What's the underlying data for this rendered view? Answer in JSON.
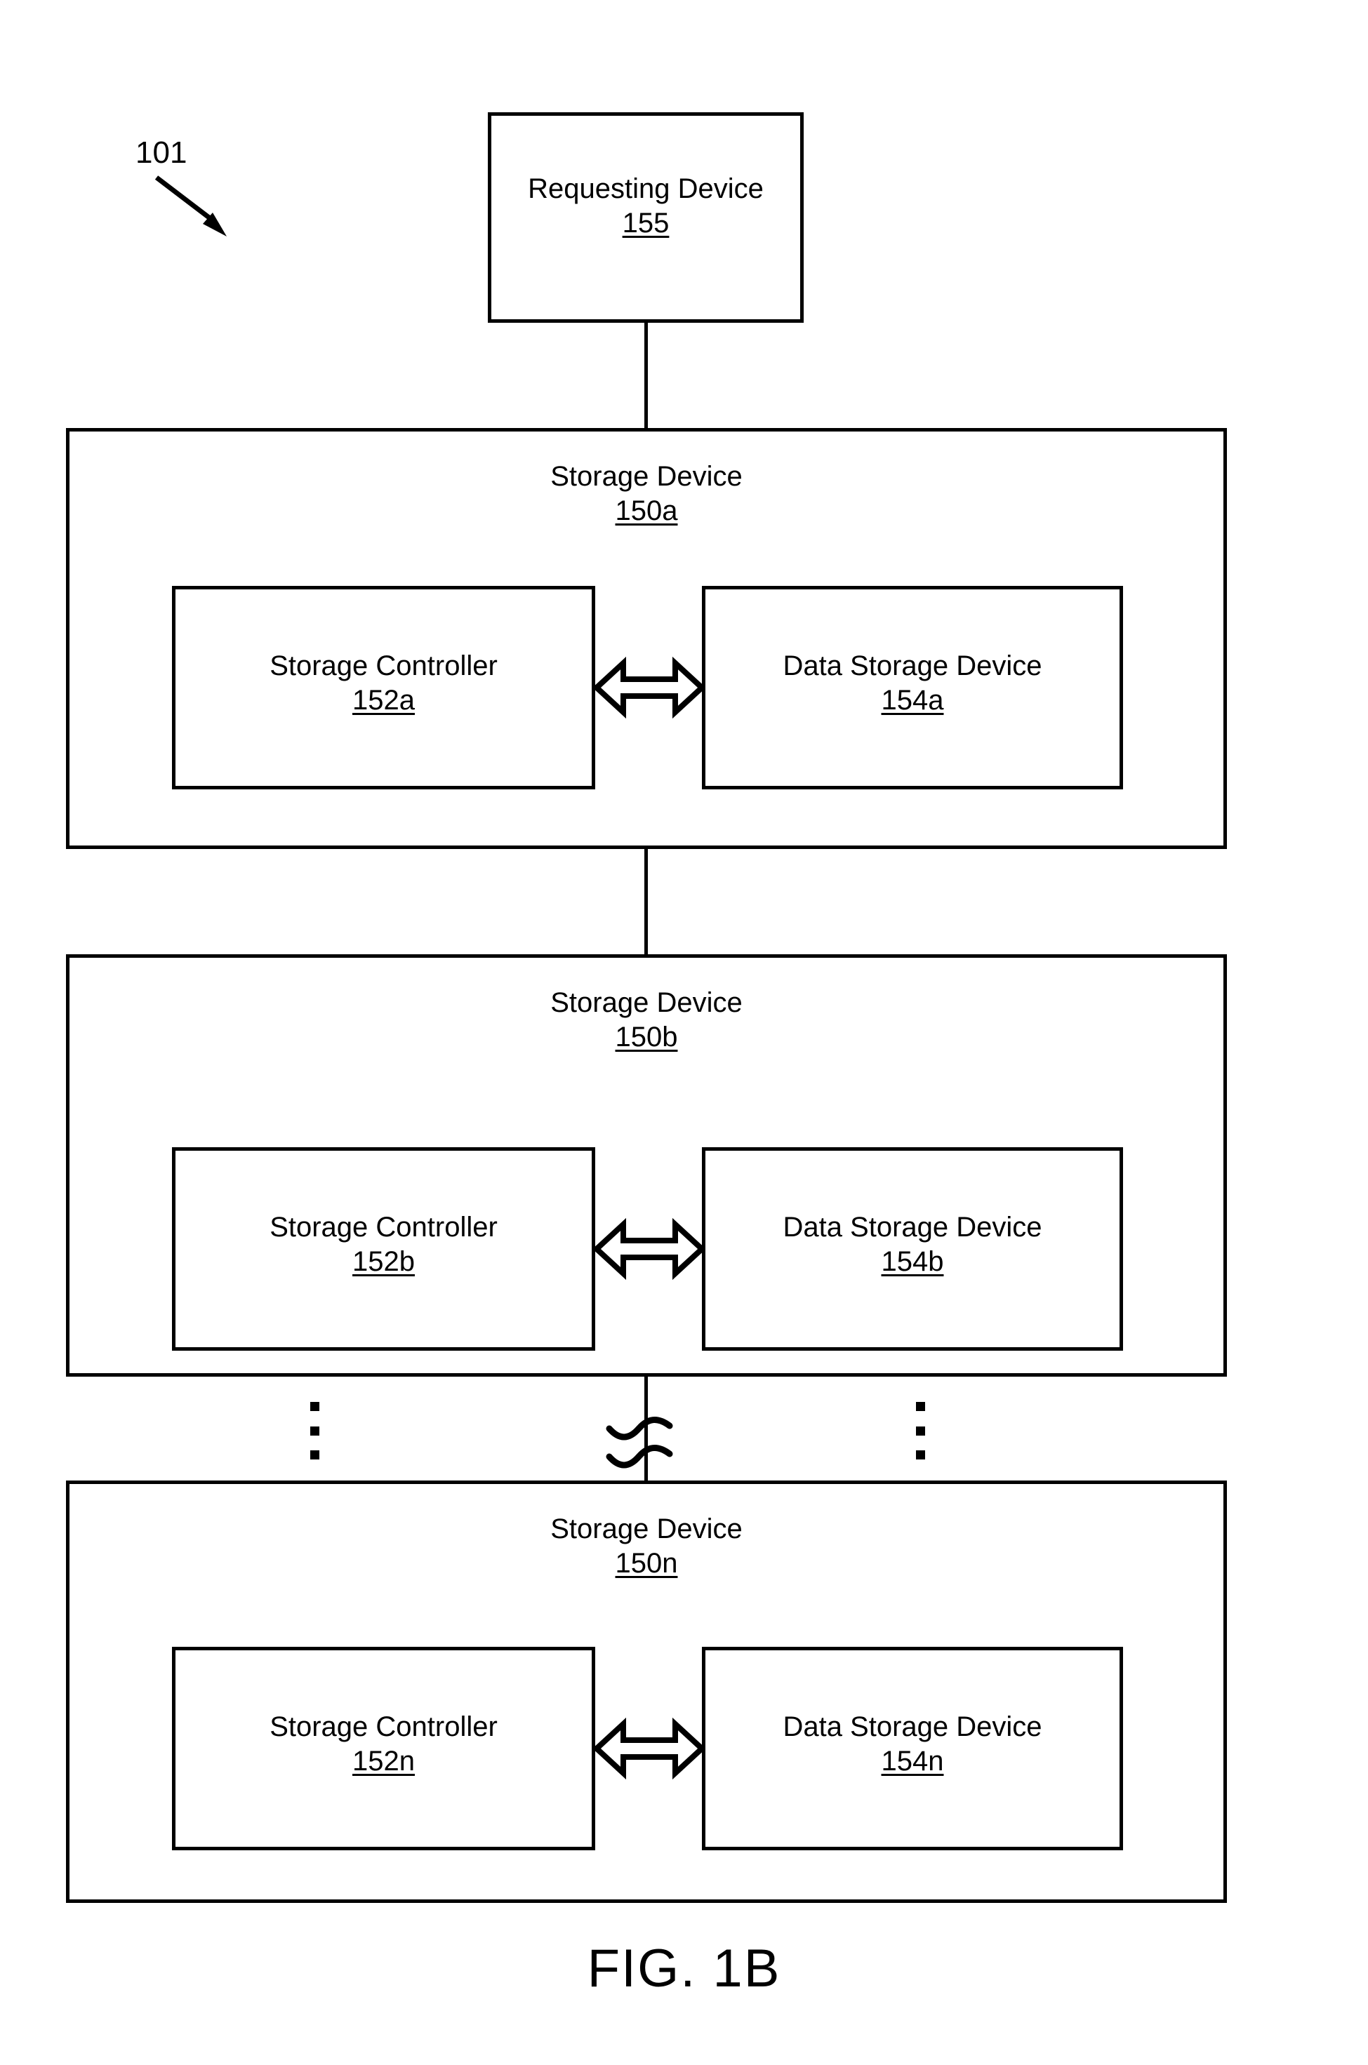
{
  "figure": {
    "caption": "FIG. 1B",
    "system_callout": "101"
  },
  "requesting_device": {
    "title": "Requesting Device",
    "ref": "155"
  },
  "storage_devices": [
    {
      "title": "Storage Device",
      "ref": "150a",
      "controller": {
        "title": "Storage Controller",
        "ref": "152a"
      },
      "data_storage": {
        "title": "Data Storage Device",
        "ref": "154a"
      },
      "link": "bidirectional-arrow"
    },
    {
      "title": "Storage Device",
      "ref": "150b",
      "controller": {
        "title": "Storage Controller",
        "ref": "152b"
      },
      "data_storage": {
        "title": "Data Storage Device",
        "ref": "154b"
      },
      "link": "bidirectional-arrow"
    },
    {
      "title": "Storage Device",
      "ref": "150n",
      "controller": {
        "title": "Storage Controller",
        "ref": "152n"
      },
      "data_storage": {
        "title": "Data Storage Device",
        "ref": "154n"
      },
      "link": "bidirectional-arrow"
    }
  ],
  "continuation": {
    "left_ellipsis": "⋮",
    "right_ellipsis": "⋮",
    "break_symbol": "line-break-squiggle"
  },
  "colors": {
    "stroke": "#000000",
    "background": "#ffffff"
  }
}
